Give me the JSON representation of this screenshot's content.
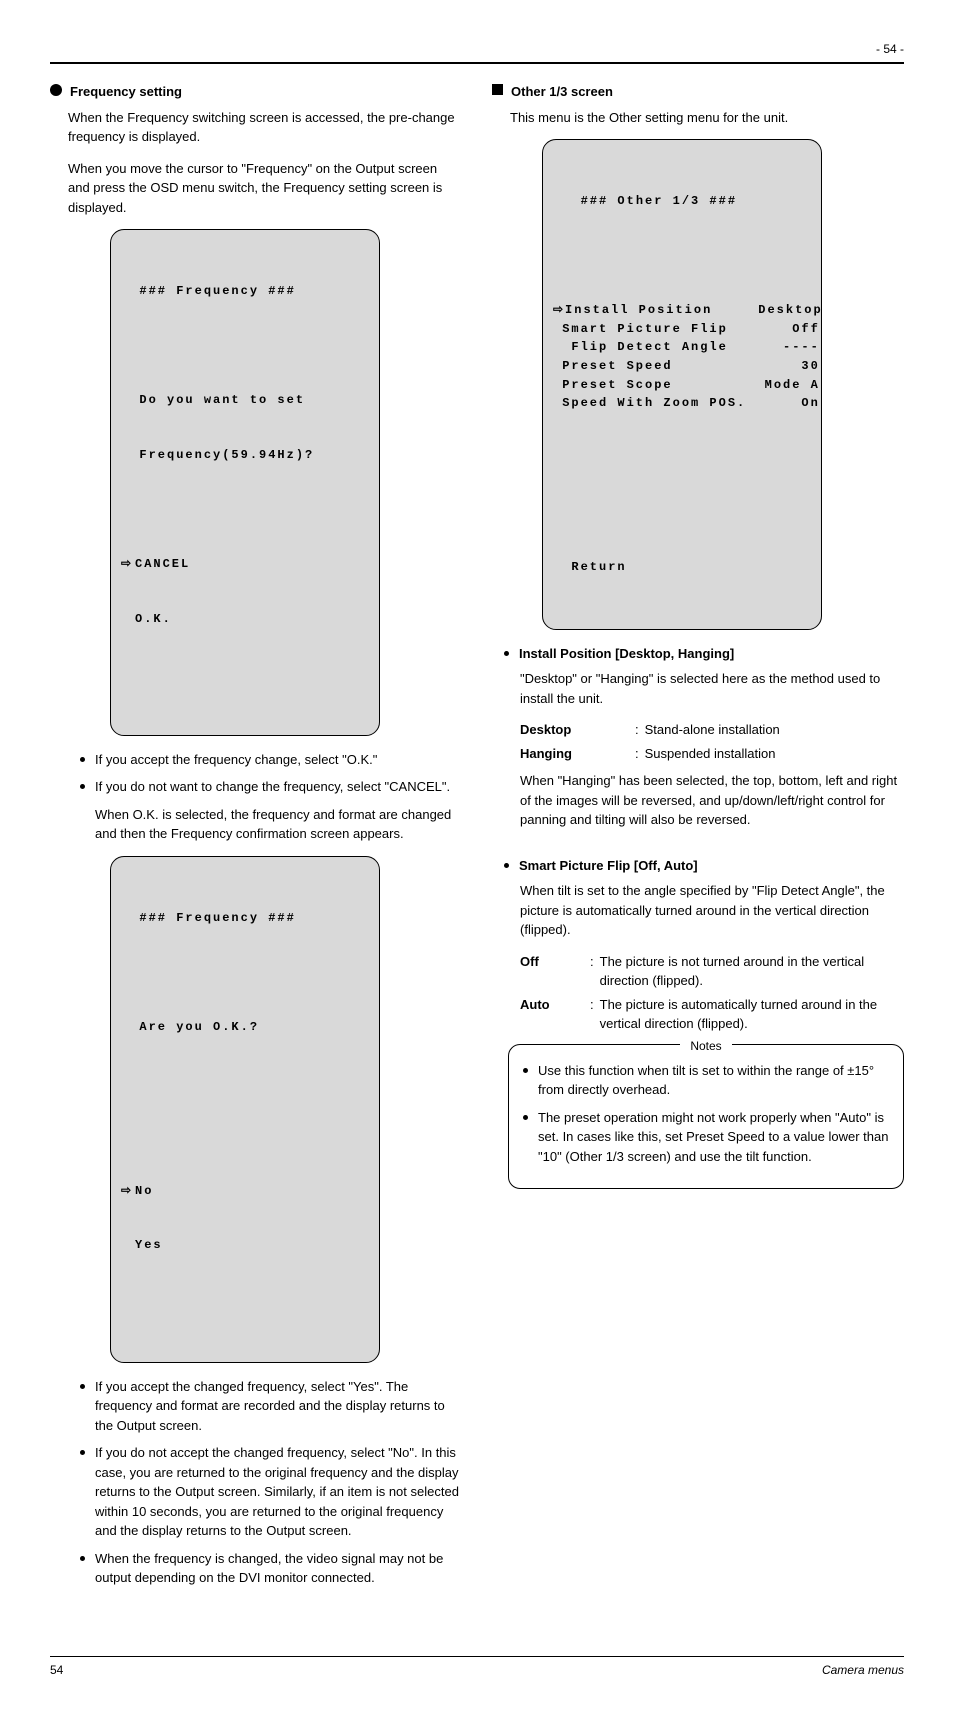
{
  "page_number": "- 54 -",
  "footer_left": "54",
  "footer_right": "Camera menus",
  "left": {
    "heading": "Frequency setting",
    "intro_p1": "When the Frequency switching screen is accessed, the pre-change frequency is displayed.",
    "intro_p2": "When you move the cursor to \"Frequency\" on the Output screen and press the OSD menu switch, the Frequency setting screen is displayed.",
    "osd1": {
      "title": "### Frequency ###",
      "prompt_l1": "Do you want to set",
      "prompt_l2": "Frequency(59.94Hz)?",
      "opt_cancel": "CANCEL",
      "opt_ok": "O.K."
    },
    "bullets1": [
      "If you accept the frequency change, select \"O.K.\"",
      "If you do not want to change the frequency, select \"CANCEL\".",
      "When O.K. is selected, the frequency and format are changed and then the Frequency confirmation screen appears."
    ],
    "osd2": {
      "title": "### Frequency ###",
      "prompt": "Are you O.K.?",
      "opt_no": "No",
      "opt_yes": "Yes"
    },
    "bullets2": [
      "If you accept the changed frequency, select \"Yes\". The frequency and format are recorded and the display returns to the Output screen.",
      "If you do not accept the changed frequency, select \"No\". In this case, you are returned to the original frequency and the display returns to the Output screen. Similarly, if an item is not selected within 10 seconds, you are returned to the original frequency and the display returns to the Output screen.",
      "When the frequency is changed, the video signal may not be output depending on the DVI monitor connected."
    ]
  },
  "right": {
    "heading": "Other 1/3 screen",
    "intro": "This menu is the Other setting menu for the unit.",
    "osd": {
      "title": "### Other 1/3 ###",
      "rows": [
        {
          "label": "Install Position",
          "value": "Desktop",
          "selected": true
        },
        {
          "label": "Smart Picture Flip",
          "value": "Off"
        },
        {
          "label": " Flip Detect Angle",
          "value": "----"
        },
        {
          "label": "Preset Speed",
          "value": "30"
        },
        {
          "label": "Preset Scope",
          "value": "Mode A"
        },
        {
          "label": "Speed With Zoom POS.",
          "value": "On"
        }
      ],
      "return": "Return"
    },
    "section1": {
      "title": "Install Position [Desktop, Hanging]",
      "desc": "\"Desktop\" or \"Hanging\" is selected here as the method used to install the unit.",
      "rows": [
        {
          "name": "Desktop",
          "value": "Stand-alone installation"
        },
        {
          "name": "Hanging",
          "value": "Suspended installation"
        }
      ],
      "note": "When \"Hanging\" has been selected, the top, bottom, left and right of the images will be reversed, and up/down/left/right control for panning and tilting will also be reversed."
    },
    "section2": {
      "title": "Smart Picture Flip [Off, Auto]",
      "desc": "When tilt is set to the angle specified by \"Flip Detect Angle\", the picture is automatically turned around in the vertical direction (flipped).",
      "rows": [
        {
          "name": "Off",
          "value": "The picture is not turned around in the vertical direction (flipped)."
        },
        {
          "name": "Auto",
          "value": "The picture is automatically turned around in the vertical direction (flipped)."
        }
      ]
    },
    "notes": {
      "title": "Notes",
      "items": [
        "Use this function when tilt is set to within the range of ±15° from directly overhead.",
        "The preset operation might not work properly when \"Auto\" is set. In cases like this, set Preset Speed to a value lower than \"10\" (Other 1/3 screen) and use the tilt function."
      ]
    }
  }
}
